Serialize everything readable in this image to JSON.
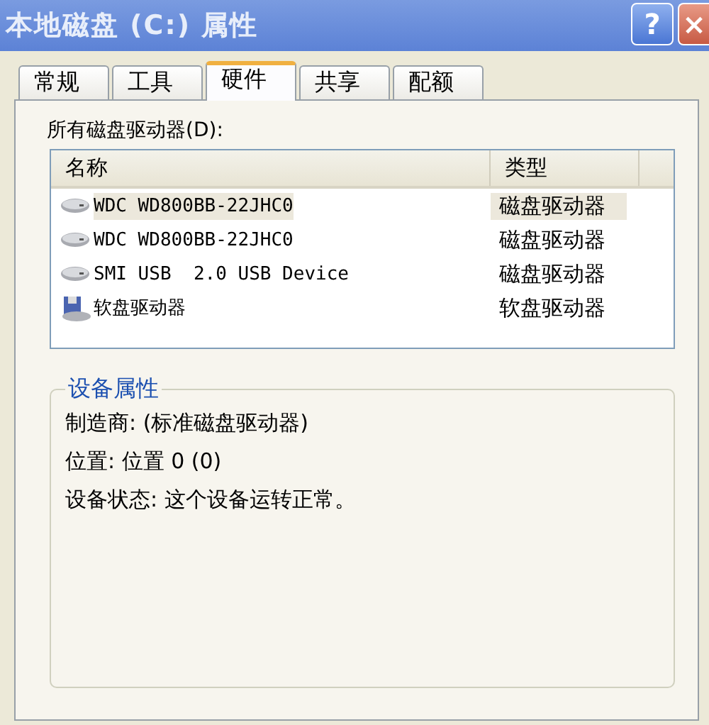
{
  "window": {
    "title": "本地磁盘 (C:) 属性",
    "help_button": "?",
    "close_button": "×"
  },
  "tabs": [
    {
      "label": "常规",
      "selected": false
    },
    {
      "label": "工具",
      "selected": false
    },
    {
      "label": "硬件",
      "selected": true
    },
    {
      "label": "共享",
      "selected": false
    },
    {
      "label": "配额",
      "selected": false
    }
  ],
  "drives": {
    "label": "所有磁盘驱动器(D):",
    "columns": [
      "名称",
      "类型"
    ],
    "rows": [
      {
        "name": "WDC WD800BB-22JHC0",
        "type": "磁盘驱动器",
        "kind": "disk",
        "selected": true
      },
      {
        "name": "WDC WD800BB-22JHC0",
        "type": "磁盘驱动器",
        "kind": "disk",
        "selected": false
      },
      {
        "name": "SMI USB  2.0 USB Device",
        "type": "磁盘驱动器",
        "kind": "disk",
        "selected": false
      },
      {
        "name": "软盘驱动器",
        "type": "软盘驱动器",
        "kind": "floppy",
        "selected": false
      }
    ]
  },
  "device_properties": {
    "title": "设备属性",
    "lines": [
      "制造商: (标准磁盘驱动器)",
      "位置: 位置 0 (0)",
      "设备状态: 这个设备运转正常。"
    ]
  }
}
